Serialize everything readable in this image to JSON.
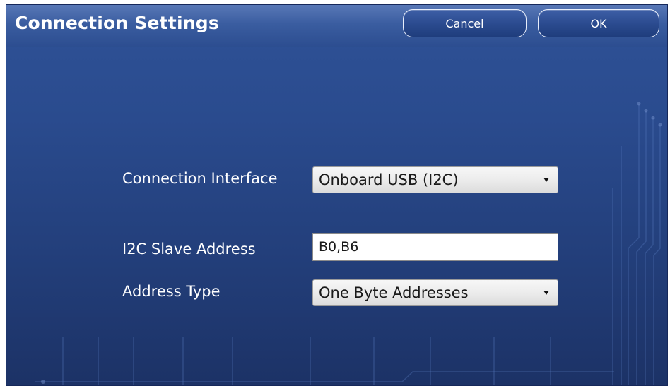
{
  "window": {
    "title": "Connection Settings"
  },
  "buttons": {
    "cancel_label": "Cancel",
    "ok_label": "OK"
  },
  "form": {
    "connection_interface": {
      "label": "Connection Interface",
      "value": "Onboard USB (I2C)"
    },
    "slave_address": {
      "label": "I2C Slave Address",
      "value": "B0,B6"
    },
    "address_type": {
      "label": "Address Type",
      "value": "One Byte Addresses"
    }
  },
  "colors": {
    "background_top": "#2f5297",
    "background_bottom": "#1c3266",
    "titlebar": "#3a5da0",
    "text": "#ffffff"
  }
}
